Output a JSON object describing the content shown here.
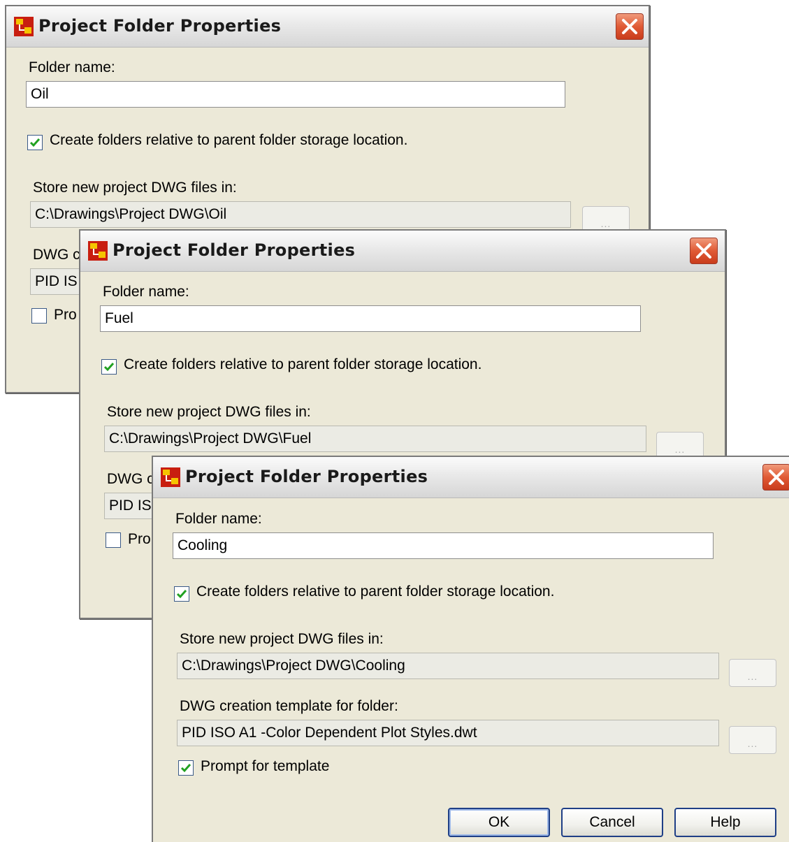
{
  "dialogs": [
    {
      "title": "Project Folder Properties",
      "folder_name_label": "Folder name:",
      "folder_name_value": "Oil",
      "relative_checkbox_label": "Create folders relative to parent folder storage location.",
      "relative_checked": true,
      "store_label": "Store new project DWG files in:",
      "store_value": "C:\\Drawings\\Project DWG\\Oil",
      "template_label_partial": "DWG c",
      "template_value_partial": "PID IS",
      "prompt_label_partial": "Pro",
      "prompt_checked": false,
      "browse_label": "..."
    },
    {
      "title": "Project Folder Properties",
      "folder_name_label": "Folder name:",
      "folder_name_value": "Fuel",
      "relative_checkbox_label": "Create folders relative to parent folder storage location.",
      "relative_checked": true,
      "store_label": "Store new project DWG files in:",
      "store_value": "C:\\Drawings\\Project DWG\\Fuel",
      "template_label_partial": "DWG c",
      "template_value_partial": "PID IS",
      "prompt_label_partial": "Pro",
      "prompt_checked": false,
      "browse_label": "..."
    },
    {
      "title": "Project Folder Properties",
      "folder_name_label": "Folder name:",
      "folder_name_value": "Cooling",
      "relative_checkbox_label": "Create folders relative to parent folder storage location.",
      "relative_checked": true,
      "store_label": "Store new project DWG files in:",
      "store_value": "C:\\Drawings\\Project DWG\\Cooling",
      "template_label": "DWG creation template for folder:",
      "template_value": "PID ISO A1 -Color Dependent Plot Styles.dwt",
      "prompt_label": "Prompt for template",
      "prompt_checked": true,
      "browse_label": "...",
      "buttons": {
        "ok": "OK",
        "cancel": "Cancel",
        "help": "Help"
      }
    }
  ],
  "colors": {
    "dialog_bg": "#ece9d8",
    "close_red": "#e05a35",
    "check_green": "#21a121",
    "button_border": "#1f3f86"
  },
  "icons": {
    "app": "project-manager-icon",
    "close": "close-icon",
    "check": "checkmark-icon"
  }
}
